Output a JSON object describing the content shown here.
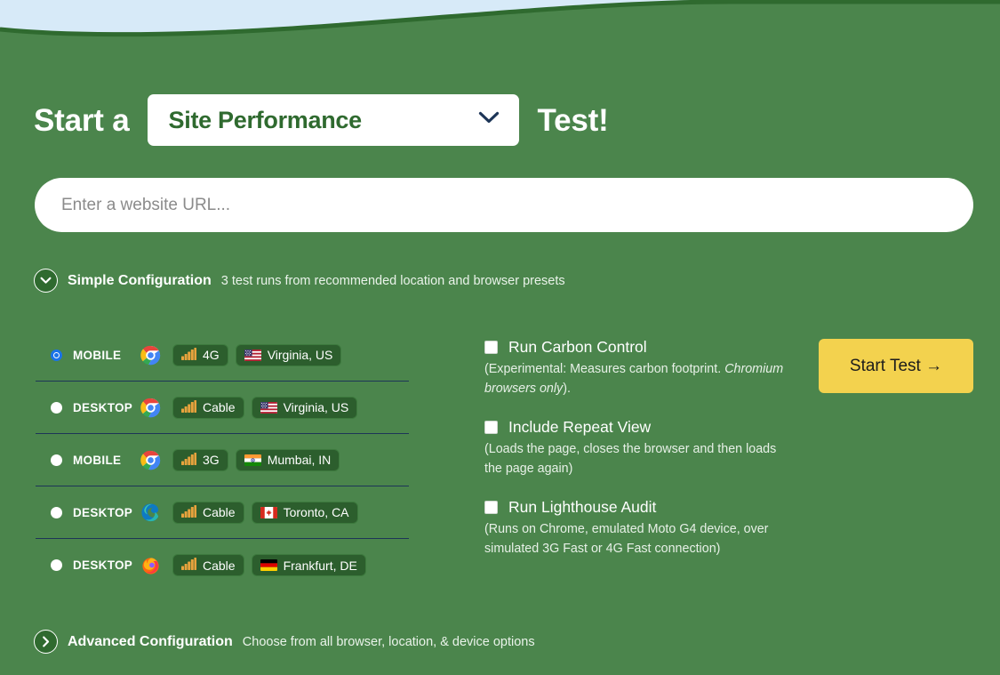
{
  "theme": {
    "page_bg": "#4b854c",
    "curve_top": "#d7eaf8",
    "curve_stroke": "#2f6a2f",
    "accent_button": "#f3d24e",
    "pill_bg": "#2c5e2d",
    "radio_selected": "#1a73e8",
    "divider": "#1d3557"
  },
  "headline": {
    "prefix": "Start a",
    "suffix": "Test!",
    "test_type": "Site Performance",
    "chevron_icon": "chevron-down-icon"
  },
  "url": {
    "value": "",
    "placeholder": "Enter a website URL..."
  },
  "simple_config": {
    "toggle_icon": "chevron-down-icon",
    "title": "Simple Configuration",
    "subtitle": "3 test runs from recommended location and browser presets",
    "presets": [
      {
        "device": "MOBILE",
        "browser": "chrome",
        "connection": "4G",
        "connection_icon": "signal-bars-icon",
        "location": "Virginia, US",
        "flag": "us",
        "selected": true
      },
      {
        "device": "DESKTOP",
        "browser": "chrome",
        "connection": "Cable",
        "connection_icon": "signal-bars-icon",
        "location": "Virginia, US",
        "flag": "us",
        "selected": false
      },
      {
        "device": "MOBILE",
        "browser": "chrome",
        "connection": "3G",
        "connection_icon": "signal-bars-icon",
        "location": "Mumbai, IN",
        "flag": "in",
        "selected": false
      },
      {
        "device": "DESKTOP",
        "browser": "edge",
        "connection": "Cable",
        "connection_icon": "signal-bars-icon",
        "location": "Toronto, CA",
        "flag": "ca",
        "selected": false
      },
      {
        "device": "DESKTOP",
        "browser": "firefox",
        "connection": "Cable",
        "connection_icon": "signal-bars-icon",
        "location": "Frankfurt, DE",
        "flag": "de",
        "selected": false
      }
    ]
  },
  "options": [
    {
      "label": "Run Carbon Control",
      "checked": false,
      "desc_plain_1": "(Experimental: Measures carbon footprint. ",
      "desc_italic": "Chromium browsers only",
      "desc_plain_2": ")."
    },
    {
      "label": "Include Repeat View",
      "checked": false,
      "desc_plain_1": "(Loads the page, closes the browser and then loads the page again)",
      "desc_italic": "",
      "desc_plain_2": ""
    },
    {
      "label": "Run Lighthouse Audit",
      "checked": false,
      "desc_plain_1": "(Runs on Chrome, emulated Moto G4 device, over simulated 3G Fast or 4G Fast connection)",
      "desc_italic": "",
      "desc_plain_2": ""
    }
  ],
  "start_button": {
    "label": "Start Test →"
  },
  "advanced_config": {
    "toggle_icon": "chevron-right-icon",
    "title": "Advanced Configuration",
    "subtitle": "Choose from all browser, location, & device options"
  }
}
